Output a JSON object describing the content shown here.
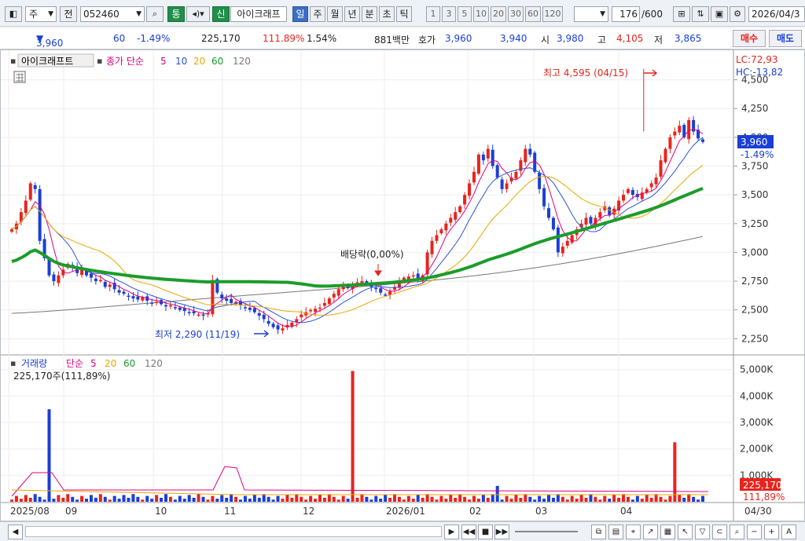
{
  "toolbar": {
    "stock_type": "주",
    "prev_label": "전",
    "code": "052460",
    "tong": "통",
    "sin": "신",
    "name": "아이크래프",
    "periods": [
      "일",
      "주",
      "월",
      "년",
      "분",
      "초",
      "틱"
    ],
    "period_selected": "일",
    "minutes": [
      "1",
      "3",
      "5",
      "10",
      "20",
      "30",
      "60",
      "120"
    ],
    "count": "176",
    "total": "/600",
    "date": "2026/04/3"
  },
  "quote": {
    "price": "3,960",
    "change": "60",
    "change_pct": "-1.49%",
    "volume": "225,170",
    "vol_ratio": "111.89%",
    "turnover": "1.54%",
    "amount": "881백만",
    "hoga_label": "호가",
    "ask": "3,960",
    "bid": "3,940",
    "open_label": "시",
    "open": "3,980",
    "high_label": "고",
    "high": "4,105",
    "low_label": "저",
    "low": "3,865",
    "buy_label": "매수",
    "sell_label": "매도"
  },
  "legend": {
    "name": "아이크래프트",
    "ma_label": "종가 단순",
    "ma": [
      "5",
      "10",
      "20",
      "60",
      "120"
    ],
    "vol_name": "거래량",
    "vol_ma_label": "단순",
    "vol_ma": [
      "5",
      "20",
      "60",
      "120"
    ],
    "vol_current": "225,170주(111,89%)"
  },
  "annotations": {
    "high": "최고 4,595 (04/15)",
    "low": "최저 2,290 (11/19)",
    "div": "배당락(0,00%)",
    "lc": "LC:72,93",
    "hc": "HC:-13,82",
    "price_tag": "3,960",
    "pct_tag": "-1.49%",
    "vol_tag": "225,170",
    "vol_pct_tag": "111,89%"
  },
  "colors": {
    "up": "#e8241c",
    "down": "#1a3fd6",
    "ma60": "#1c9c2a",
    "ma20": "#e8a800",
    "ma10": "#2c52d8",
    "ma5": "#e0007f",
    "ma120": "#777777"
  },
  "chart_data": [
    {
      "type": "candlestick",
      "title": "아이크래프트",
      "y_ticks": [
        "4,500",
        "4,250",
        "4,000",
        "3,750",
        "3,500",
        "3,250",
        "3,000",
        "2,750",
        "2,500",
        "2,250"
      ],
      "ylim": [
        2150,
        4620
      ],
      "x_ticks": [
        "2025/08",
        "09",
        "10",
        "11",
        "12",
        "2026/01",
        "02",
        "03",
        "04",
        "04/30"
      ],
      "high": {
        "value": 4595,
        "date": "04/15"
      },
      "low": {
        "value": 2290,
        "date": "11/19"
      },
      "closes": [
        3200,
        3250,
        3350,
        3450,
        3600,
        3550,
        3100,
        2950,
        2800,
        2750,
        2800,
        2850,
        2900,
        2870,
        2820,
        2850,
        2800,
        2780,
        2750,
        2760,
        2700,
        2720,
        2680,
        2650,
        2640,
        2620,
        2600,
        2590,
        2610,
        2580,
        2560,
        2570,
        2550,
        2530,
        2540,
        2520,
        2500,
        2490,
        2480,
        2470,
        2460,
        2450,
        2470,
        2760,
        2650,
        2600,
        2580,
        2560,
        2570,
        2540,
        2520,
        2500,
        2480,
        2450,
        2420,
        2380,
        2350,
        2330,
        2340,
        2370,
        2390,
        2420,
        2460,
        2480,
        2500,
        2510,
        2520,
        2560,
        2600,
        2640,
        2680,
        2700,
        2690,
        2720,
        2740,
        2750,
        2720,
        2700,
        2680,
        2650,
        2630,
        2660,
        2700,
        2740,
        2780,
        2790,
        2800,
        2760,
        2800,
        3000,
        3100,
        3150,
        3200,
        3250,
        3300,
        3350,
        3400,
        3500,
        3600,
        3700,
        3850,
        3800,
        3900,
        3750,
        3650,
        3550,
        3600,
        3650,
        3700,
        3800,
        3900,
        3850,
        3700,
        3550,
        3400,
        3300,
        3200,
        3000,
        3050,
        3100,
        3150,
        3200,
        3250,
        3300,
        3250,
        3300,
        3350,
        3400,
        3320,
        3380,
        3450,
        3500,
        3550,
        3500,
        3480,
        3520,
        3550,
        3600,
        3650,
        3800,
        3900,
        4000,
        4050,
        4100,
        4000,
        4150,
        4050,
        3990,
        3960
      ],
      "ma60_y_start": 2640,
      "ma60_y_end": 3570,
      "ma120_y_start": 2470,
      "ma120_y_end": 3150
    },
    {
      "type": "bar",
      "title": "거래량",
      "y_ticks": [
        "5,000K",
        "4,000K",
        "3,000K",
        "2,000K",
        "1,000K"
      ],
      "ylim": [
        0,
        5200
      ],
      "spikes": [
        {
          "date": "08",
          "value": 3500
        },
        {
          "date": "11",
          "value": 4950
        },
        {
          "date": "12",
          "value": 600
        },
        {
          "date": "2026/01",
          "value": 2250
        },
        {
          "date": "02",
          "value": 850
        },
        {
          "date": "04",
          "value": 950
        }
      ]
    }
  ]
}
